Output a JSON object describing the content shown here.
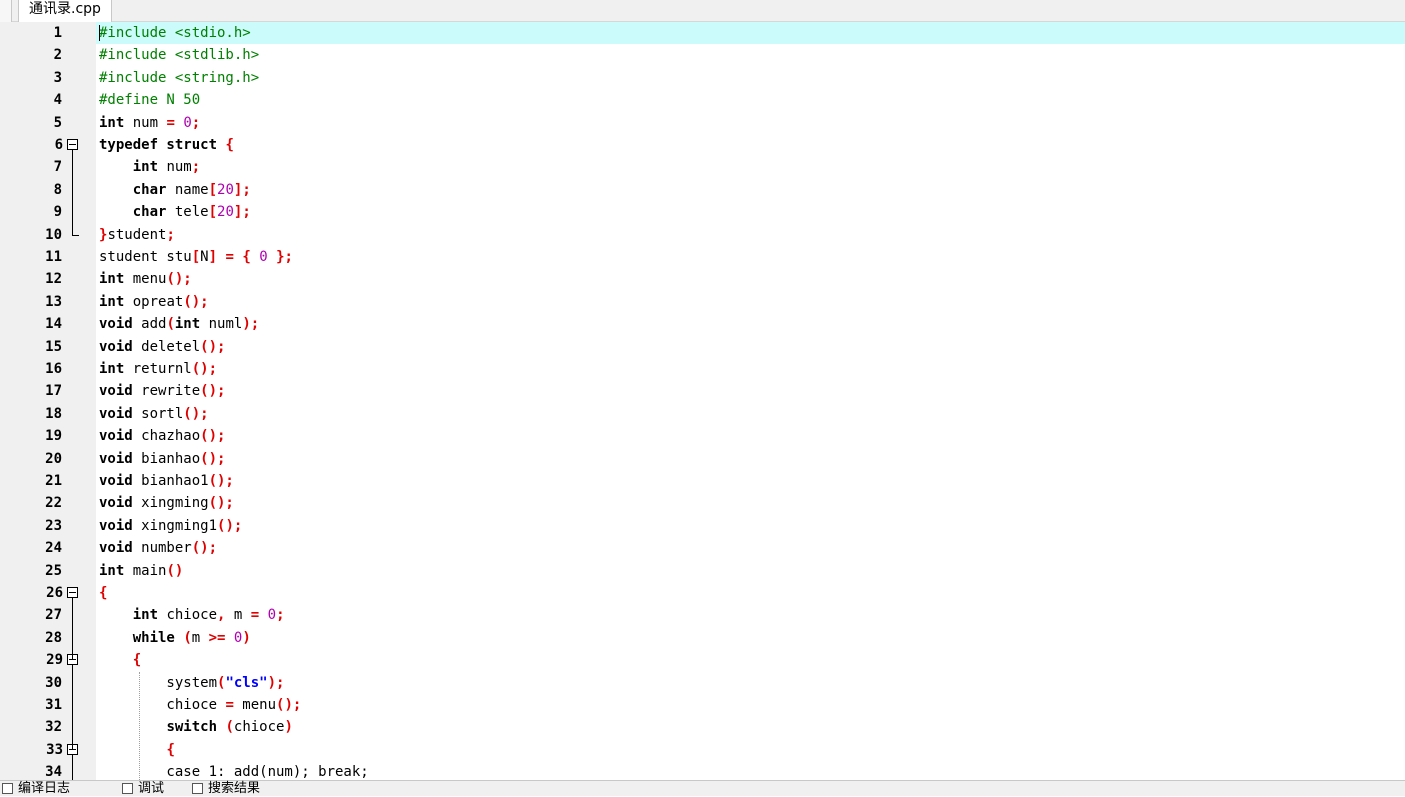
{
  "tab": {
    "filename": "通讯录.cpp"
  },
  "editor": {
    "current_line": 1,
    "lines": [
      {
        "n": "1",
        "tokens": [
          [
            "pp",
            "#include <stdio.h>"
          ]
        ]
      },
      {
        "n": "2",
        "tokens": [
          [
            "pp",
            "#include <stdlib.h>"
          ]
        ]
      },
      {
        "n": "3",
        "tokens": [
          [
            "pp",
            "#include <string.h>"
          ]
        ]
      },
      {
        "n": "4",
        "tokens": [
          [
            "pp",
            "#define N 50"
          ]
        ]
      },
      {
        "n": "5",
        "tokens": [
          [
            "kw",
            "int"
          ],
          [
            "id",
            " num "
          ],
          [
            "op",
            "="
          ],
          [
            "id",
            " "
          ],
          [
            "num",
            "0"
          ],
          [
            "op",
            ";"
          ]
        ]
      },
      {
        "n": "6",
        "fold": true,
        "tokens": [
          [
            "kw",
            "typedef struct"
          ],
          [
            "id",
            " "
          ],
          [
            "op",
            "{"
          ]
        ]
      },
      {
        "n": "7",
        "tokens": [
          [
            "id",
            "    "
          ],
          [
            "kw",
            "int"
          ],
          [
            "id",
            " num"
          ],
          [
            "op",
            ";"
          ]
        ]
      },
      {
        "n": "8",
        "tokens": [
          [
            "id",
            "    "
          ],
          [
            "kw",
            "char"
          ],
          [
            "id",
            " name"
          ],
          [
            "op",
            "["
          ],
          [
            "num",
            "20"
          ],
          [
            "op",
            "];"
          ]
        ]
      },
      {
        "n": "9",
        "tokens": [
          [
            "id",
            "    "
          ],
          [
            "kw",
            "char"
          ],
          [
            "id",
            " tele"
          ],
          [
            "op",
            "["
          ],
          [
            "num",
            "20"
          ],
          [
            "op",
            "];"
          ]
        ]
      },
      {
        "n": "10",
        "tokens": [
          [
            "op",
            "}"
          ],
          [
            "id",
            "student"
          ],
          [
            "op",
            ";"
          ]
        ]
      },
      {
        "n": "11",
        "tokens": [
          [
            "id",
            "student stu"
          ],
          [
            "op",
            "["
          ],
          [
            "id",
            "N"
          ],
          [
            "op",
            "]"
          ],
          [
            "id",
            " "
          ],
          [
            "op",
            "="
          ],
          [
            "id",
            " "
          ],
          [
            "op",
            "{"
          ],
          [
            "id",
            " "
          ],
          [
            "num",
            "0"
          ],
          [
            "id",
            " "
          ],
          [
            "op",
            "};"
          ]
        ]
      },
      {
        "n": "12",
        "tokens": [
          [
            "kw",
            "int"
          ],
          [
            "id",
            " menu"
          ],
          [
            "op",
            "();"
          ]
        ]
      },
      {
        "n": "13",
        "tokens": [
          [
            "kw",
            "int"
          ],
          [
            "id",
            " opreat"
          ],
          [
            "op",
            "();"
          ]
        ]
      },
      {
        "n": "14",
        "tokens": [
          [
            "kw",
            "void"
          ],
          [
            "id",
            " add"
          ],
          [
            "op",
            "("
          ],
          [
            "kw",
            "int"
          ],
          [
            "id",
            " numl"
          ],
          [
            "op",
            ");"
          ]
        ]
      },
      {
        "n": "15",
        "tokens": [
          [
            "kw",
            "void"
          ],
          [
            "id",
            " deletel"
          ],
          [
            "op",
            "();"
          ]
        ]
      },
      {
        "n": "16",
        "tokens": [
          [
            "kw",
            "int"
          ],
          [
            "id",
            " returnl"
          ],
          [
            "op",
            "();"
          ]
        ]
      },
      {
        "n": "17",
        "tokens": [
          [
            "kw",
            "void"
          ],
          [
            "id",
            " rewrite"
          ],
          [
            "op",
            "();"
          ]
        ]
      },
      {
        "n": "18",
        "tokens": [
          [
            "kw",
            "void"
          ],
          [
            "id",
            " sortl"
          ],
          [
            "op",
            "();"
          ]
        ]
      },
      {
        "n": "19",
        "tokens": [
          [
            "kw",
            "void"
          ],
          [
            "id",
            " chazhao"
          ],
          [
            "op",
            "();"
          ]
        ]
      },
      {
        "n": "20",
        "tokens": [
          [
            "kw",
            "void"
          ],
          [
            "id",
            " bianhao"
          ],
          [
            "op",
            "();"
          ]
        ]
      },
      {
        "n": "21",
        "tokens": [
          [
            "kw",
            "void"
          ],
          [
            "id",
            " bianhao1"
          ],
          [
            "op",
            "();"
          ]
        ]
      },
      {
        "n": "22",
        "tokens": [
          [
            "kw",
            "void"
          ],
          [
            "id",
            " xingming"
          ],
          [
            "op",
            "();"
          ]
        ]
      },
      {
        "n": "23",
        "tokens": [
          [
            "kw",
            "void"
          ],
          [
            "id",
            " xingming1"
          ],
          [
            "op",
            "();"
          ]
        ]
      },
      {
        "n": "24",
        "tokens": [
          [
            "kw",
            "void"
          ],
          [
            "id",
            " number"
          ],
          [
            "op",
            "();"
          ]
        ]
      },
      {
        "n": "25",
        "tokens": [
          [
            "kw",
            "int"
          ],
          [
            "id",
            " main"
          ],
          [
            "op",
            "()"
          ]
        ]
      },
      {
        "n": "26",
        "fold": true,
        "tokens": [
          [
            "op",
            "{"
          ]
        ]
      },
      {
        "n": "27",
        "tokens": [
          [
            "id",
            "    "
          ],
          [
            "kw",
            "int"
          ],
          [
            "id",
            " chioce"
          ],
          [
            "op",
            ","
          ],
          [
            "id",
            " m "
          ],
          [
            "op",
            "="
          ],
          [
            "id",
            " "
          ],
          [
            "num",
            "0"
          ],
          [
            "op",
            ";"
          ]
        ]
      },
      {
        "n": "28",
        "tokens": [
          [
            "id",
            "    "
          ],
          [
            "kw",
            "while"
          ],
          [
            "id",
            " "
          ],
          [
            "op",
            "("
          ],
          [
            "id",
            "m "
          ],
          [
            "op",
            ">="
          ],
          [
            "id",
            " "
          ],
          [
            "num",
            "0"
          ],
          [
            "op",
            ")"
          ]
        ]
      },
      {
        "n": "29",
        "fold": true,
        "tokens": [
          [
            "id",
            "    "
          ],
          [
            "op",
            "{"
          ]
        ]
      },
      {
        "n": "30",
        "tokens": [
          [
            "id",
            "        system"
          ],
          [
            "op",
            "("
          ],
          [
            "str",
            "\"cls\""
          ],
          [
            "op",
            ");"
          ]
        ]
      },
      {
        "n": "31",
        "tokens": [
          [
            "id",
            "        chioce "
          ],
          [
            "op",
            "="
          ],
          [
            "id",
            " menu"
          ],
          [
            "op",
            "();"
          ]
        ]
      },
      {
        "n": "32",
        "tokens": [
          [
            "id",
            "        "
          ],
          [
            "kw",
            "switch"
          ],
          [
            "id",
            " "
          ],
          [
            "op",
            "("
          ],
          [
            "id",
            "chioce"
          ],
          [
            "op",
            ")"
          ]
        ]
      },
      {
        "n": "33",
        "fold": true,
        "tokens": [
          [
            "id",
            "        "
          ],
          [
            "op",
            "{"
          ]
        ]
      },
      {
        "n": "34",
        "tokens": [
          [
            "id",
            "        case 1: add(num); break;"
          ]
        ]
      }
    ]
  },
  "bottom_tabs": [
    {
      "label": "编译日志",
      "icon": "compile-log-icon"
    },
    {
      "label": "调试",
      "icon": "debug-icon"
    },
    {
      "label": "搜索结果",
      "icon": "search-results-icon"
    }
  ]
}
